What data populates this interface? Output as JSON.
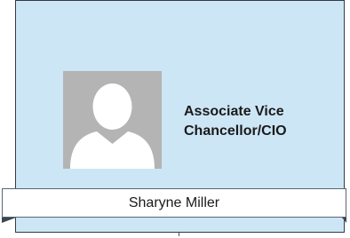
{
  "card": {
    "title": "Associate Vice Chancellor/CIO",
    "name": "Sharyne Miller",
    "avatar_icon": "person-placeholder-icon"
  },
  "colors": {
    "card_background": "#cde6f6",
    "card_border": "#333b44",
    "avatar_background": "#b4b4b4",
    "avatar_figure": "#ffffff"
  }
}
